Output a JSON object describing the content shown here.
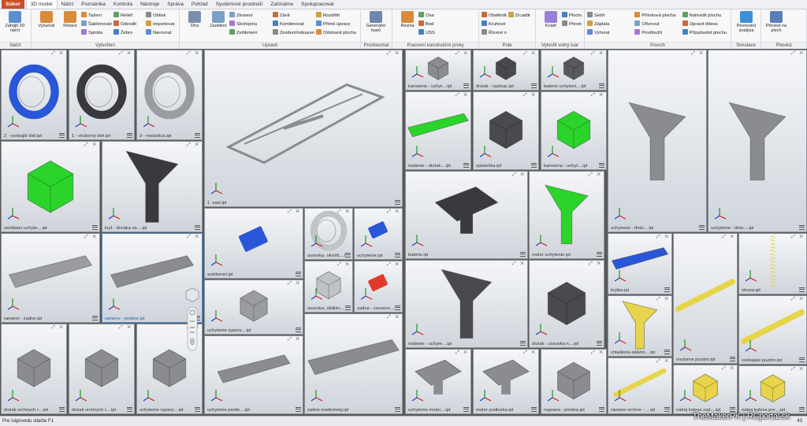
{
  "tabs": [
    "Súbor",
    "3D model",
    "Náčrt",
    "Poznámka",
    "Kontrola",
    "Nástroje",
    "Správa",
    "Pohľad",
    "Systémové prostredí",
    "Začínáme",
    "Spolupracovat"
  ],
  "active_tab": "3D model",
  "ribbon": {
    "panels": [
      {
        "label": "Náčrt",
        "big": [
          {
            "label": "Zahájit 2D náčrt",
            "color": "#5a8fd1"
          }
        ],
        "small": []
      },
      {
        "label": "Vytvoření",
        "big": [
          {
            "label": "Vysunutí",
            "color": "#d98b3a"
          },
          {
            "label": "Rotace",
            "color": "#d98b3a"
          }
        ],
        "small": [
          "Tažení",
          "Šablonování",
          "Spirála",
          "Reliéf",
          "Odvodit",
          "Žebro",
          "Obtisk",
          "Importovat",
          "Narovnat"
        ]
      },
      {
        "label": "Upravit",
        "big": [
          {
            "label": "Díra",
            "color": "#7a8fb0"
          },
          {
            "label": "Zaoblení",
            "color": "#7aa0c8"
          }
        ],
        "small": [
          "Zkosení",
          "Skořepina",
          "Zešikmení",
          "Závit",
          "Kombinovat",
          "Zesílení/odsazení",
          "Rozdělit",
          "Přímé úpravy",
          "Odstranit plochu"
        ]
      },
      {
        "label": "Prozkoumat",
        "big": [
          {
            "label": "Generátor tvarů",
            "color": "#6f87b0"
          }
        ],
        "small": []
      },
      {
        "label": "Pracovní konstrukční prvky",
        "big": [
          {
            "label": "Rovina",
            "color": "#d98b3a"
          }
        ],
        "small": [
          "Osa",
          "Bod",
          "USS"
        ]
      },
      {
        "label": "Pole",
        "big": [],
        "small": [
          "Obdélníkové",
          "Kruhové",
          "Řízené náčrtem",
          "Zrcadlit"
        ]
      },
      {
        "label": "Vytvořit volný tvar",
        "big": [
          {
            "label": "Kvádr",
            "color": "#9a7fd8"
          }
        ],
        "small": [
          "Plocha",
          "Převést"
        ]
      },
      {
        "label": "Povrch",
        "big": [],
        "small": [
          "Sešít",
          "Záplata",
          "Vyřezat",
          "Přímková plocha",
          "Oříznout",
          "Prodloužit",
          "Nahradit plochu",
          "Opravit tělesa",
          "Přizpůsobit plochu sítě"
        ]
      },
      {
        "label": "Simulace",
        "big": [
          {
            "label": "Pevnostní analýza",
            "color": "#3f8fd6"
          }
        ],
        "small": []
      },
      {
        "label": "Převést",
        "big": [
          {
            "label": "Převést na plech",
            "color": "#5a7fb8"
          }
        ],
        "small": []
      }
    ]
  },
  "tiles": [
    {
      "title": "2 - vonkajší diel.ipt",
      "color": "#2a56d8",
      "shape": "ring"
    },
    {
      "title": "1 - vnútorný diel.ipt",
      "color": "#3a3a3e",
      "shape": "ring"
    },
    {
      "title": "3 - medzikus.ipt",
      "color": "#9a9ca2",
      "shape": "ring"
    },
    {
      "title": "1. sasi.ipt",
      "color": "#8a8c92",
      "shape": "frame"
    },
    {
      "title": "karoseria - uchyt....ipt",
      "color": "#8a8c92",
      "shape": "block"
    },
    {
      "title": "drziak - vypinac.ipt",
      "color": "#4a4a4e",
      "shape": "block"
    },
    {
      "title": "baterie uchyteni....ipt",
      "color": "#5a5a5e",
      "shape": "block"
    },
    {
      "title": "uchytenie - tlmic....ipt",
      "color": "#8a8c92",
      "shape": "arm"
    },
    {
      "title": "uchytenie - tlmic....ipt",
      "color": "#8a8c92",
      "shape": "arm"
    },
    {
      "title": "riadenie - drziak....ipt",
      "color": "#2bd42b",
      "shape": "bar"
    },
    {
      "title": "spiatočka.ipt",
      "color": "#4a4a4e",
      "shape": "block"
    },
    {
      "title": "karoseria - uchyt....ipt",
      "color": "#2bd42b",
      "shape": "block"
    },
    {
      "title": "ventilator uchyte....ipt",
      "color": "#2bd42b",
      "shape": "block"
    },
    {
      "title": "kryt - drziaka ve....ipt",
      "color": "#3a3a3e",
      "shape": "arm"
    },
    {
      "title": "baterie.ipt",
      "color": "#3a3a3e",
      "shape": "tray"
    },
    {
      "title": "motor uchytenie.ipt",
      "color": "#2bd42b",
      "shape": "arm"
    },
    {
      "title": "svetlomet.ipt",
      "color": "#2a56d8",
      "shape": "small"
    },
    {
      "title": "sosovka, okrúhl....ipt",
      "color": "#bfc3c8",
      "shape": "ring"
    },
    {
      "title": "uchytenie.ipt",
      "color": "#2a56d8",
      "shape": "small"
    },
    {
      "title": "rameno - zadne.ipt",
      "color": "#9a9ca2",
      "shape": "bar"
    },
    {
      "title": "rameno - predne.ipt",
      "color": "#8a8c92",
      "shape": "bar"
    },
    {
      "title": "sosovka, obdĺžn....ipt",
      "color": "#bfc3c8",
      "shape": "block"
    },
    {
      "title": "zadne - cervene....ipt",
      "color": "#e03a2a",
      "shape": "small"
    },
    {
      "title": "krytka.ipt",
      "color": "#2a56d8",
      "shape": "bar"
    },
    {
      "title": "vnutorne puzdro.ipt",
      "color": "#e8d44a",
      "shape": "rod"
    },
    {
      "title": "struna.ipt",
      "color": "#e8d44a",
      "shape": "spring"
    },
    {
      "title": "uchytenie vypery....ipt",
      "color": "#9a9ca2",
      "shape": "block"
    },
    {
      "title": "riadenie - uchyte....ipt",
      "color": "#4a4a4e",
      "shape": "arm"
    },
    {
      "title": "drziak - zasuvka n....ipt",
      "color": "#4a4a4e",
      "shape": "block"
    },
    {
      "title": "chladenie elektro....ipt",
      "color": "#e8d44a",
      "shape": "arm"
    },
    {
      "title": "vonkajsie puzdro.ipt",
      "color": "#e8d44a",
      "shape": "rod"
    },
    {
      "title": "drziak vrchnych r....ipt",
      "color": "#8a8c92",
      "shape": "block"
    },
    {
      "title": "drziak vrchnych r....ipt",
      "color": "#8a8c92",
      "shape": "block"
    },
    {
      "title": "uchytenie vypery....ipt",
      "color": "#8a8c92",
      "shape": "block"
    },
    {
      "title": "uchytenie predn....ipt",
      "color": "#8a8c92",
      "shape": "bar"
    },
    {
      "title": "zadne svetlomety.ipt",
      "color": "#8a8c92",
      "shape": "bar"
    },
    {
      "title": "uchytenie motor....ipt",
      "color": "#8a8c92",
      "shape": "tray"
    },
    {
      "title": "motor podlozka.ipt",
      "color": "#8a8c92",
      "shape": "tray"
    },
    {
      "title": "naprava - predna.ipt",
      "color": "#8a8c92",
      "shape": "block"
    },
    {
      "title": "rameno vrchne - ....ipt",
      "color": "#e8d44a",
      "shape": "rod"
    },
    {
      "title": "naboj kolesa zad....ipt",
      "color": "#e8d44a",
      "shape": "block"
    },
    {
      "title": "naboj kolesa pre....ipt",
      "color": "#e8d44a",
      "shape": "block"
    }
  ],
  "active_tile": 20,
  "status": "Pre nápovedu stlačte F1",
  "status_count": "43",
  "watermark": "TheMakerPK | RCportal.sk"
}
